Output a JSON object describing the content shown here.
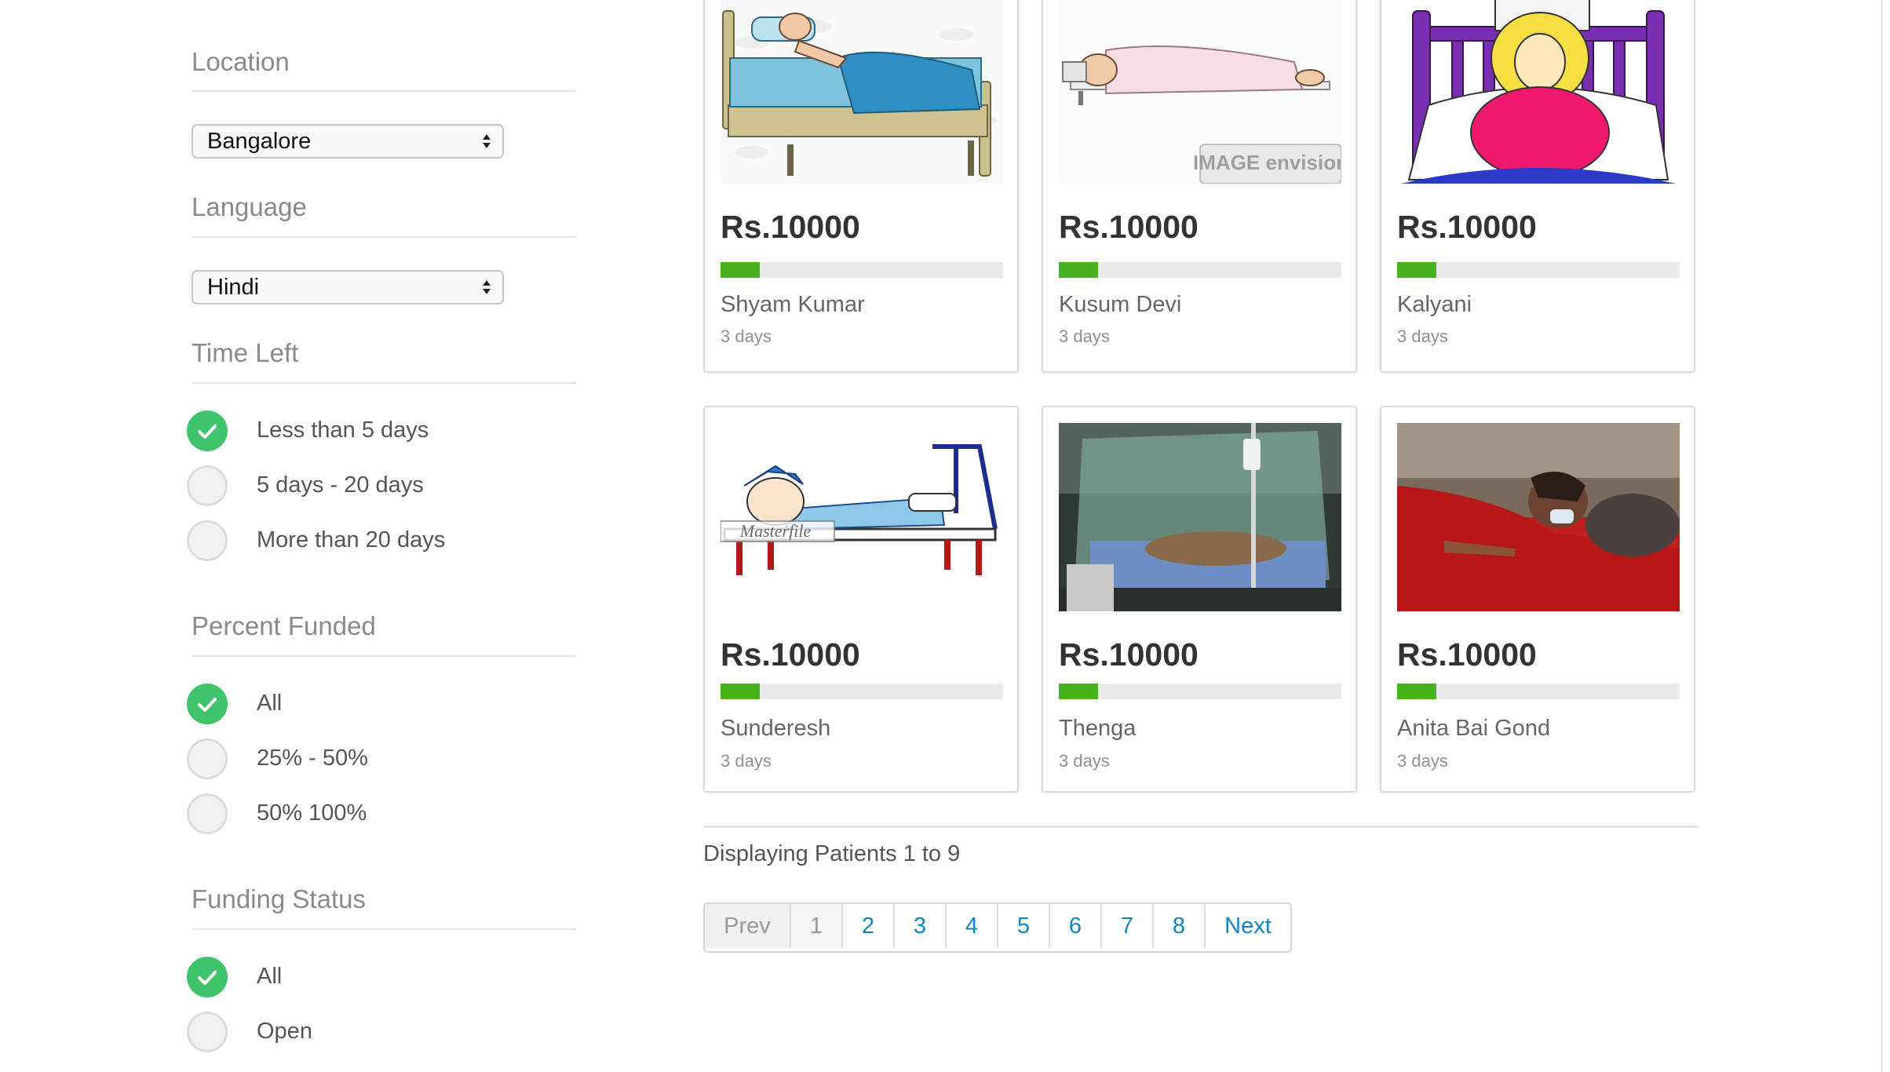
{
  "filters": {
    "location": {
      "title": "Location",
      "selected": "Bangalore"
    },
    "language": {
      "title": "Language",
      "selected": "Hindi"
    },
    "time_left": {
      "title": "Time Left",
      "options": [
        {
          "label": "Less than 5 days",
          "checked": true
        },
        {
          "label": "5 days - 20 days",
          "checked": false
        },
        {
          "label": "More than 20 days",
          "checked": false
        }
      ]
    },
    "percent_funded": {
      "title": "Percent Funded",
      "options": [
        {
          "label": "All",
          "checked": true
        },
        {
          "label": "25% - 50%",
          "checked": false
        },
        {
          "label": "50% 100%",
          "checked": false
        }
      ]
    },
    "funding_status": {
      "title": "Funding Status",
      "options": [
        {
          "label": "All",
          "checked": true
        },
        {
          "label": "Open",
          "checked": false
        }
      ]
    }
  },
  "patients": [
    {
      "amount": "Rs.10000",
      "name": "Shyam Kumar",
      "days": "3 days",
      "funded_fraction": 0.14,
      "image": "old-man-in-bed-cartoon"
    },
    {
      "amount": "Rs.10000",
      "name": "Kusum Devi",
      "days": "3 days",
      "funded_fraction": 0.14,
      "image": "man-in-hospital-bed-cartoon"
    },
    {
      "amount": "Rs.10000",
      "name": "Kalyani",
      "days": "3 days",
      "funded_fraction": 0.14,
      "image": "sick-woman-in-bed-cartoon"
    },
    {
      "amount": "Rs.10000",
      "name": "Sunderesh",
      "days": "3 days",
      "funded_fraction": 0.14,
      "image": "boy-with-leg-in-traction-cartoon"
    },
    {
      "amount": "Rs.10000",
      "name": "Thenga",
      "days": "3 days",
      "funded_fraction": 0.14,
      "image": "patient-under-mosquito-net-photo"
    },
    {
      "amount": "Rs.10000",
      "name": "Anita Bai Gond",
      "days": "3 days",
      "funded_fraction": 0.14,
      "image": "girl-with-oxygen-mask-photo"
    }
  ],
  "watermarks": {
    "image_envision": "IMAGE envision",
    "masterfile": "Masterfile"
  },
  "results": {
    "display_text": "Displaying Patients 1 to 9"
  },
  "pagination": {
    "prev": "Prev",
    "pages": [
      "1",
      "2",
      "3",
      "4",
      "5",
      "6",
      "7",
      "8"
    ],
    "current": "1",
    "next": "Next"
  },
  "colors": {
    "accent_green": "#3fc36b",
    "progress_green": "#48b21a",
    "link_blue": "#0e86c4"
  }
}
